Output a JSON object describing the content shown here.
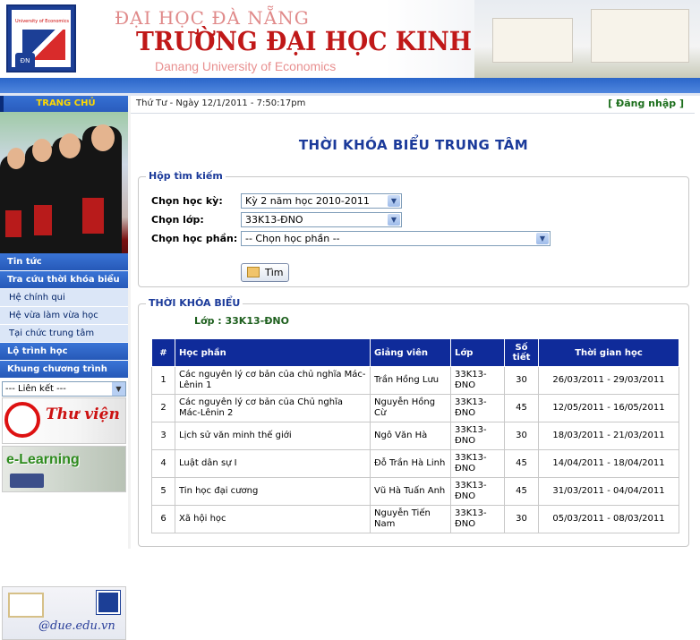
{
  "header": {
    "line1": "ĐẠI HỌC ĐÀ NẴNG",
    "line2": "TRƯỜNG ĐẠI HỌC KINH TẾ",
    "line3": "Danang University of Economics",
    "logo_text": "University of Economics",
    "logo_seal": "ĐN"
  },
  "sidebar": {
    "home": "TRANG CHỦ",
    "items": [
      {
        "label": "Tin tức",
        "type": "main"
      },
      {
        "label": "Tra cứu thời khóa biểu",
        "type": "main"
      },
      {
        "label": "Hệ chính qui",
        "type": "sub"
      },
      {
        "label": "Hệ vừa làm vừa học",
        "type": "sub"
      },
      {
        "label": "Tại chức trung tâm",
        "type": "sub"
      },
      {
        "label": "Lộ trình học",
        "type": "main"
      },
      {
        "label": "Khung chương trình",
        "type": "main"
      }
    ],
    "link_select": "--- Liên kết ---",
    "library": "Thư viện",
    "elearning": "e-Learning",
    "email": "@due.edu.vn"
  },
  "topbar": {
    "date": "Thứ Tư - Ngày 12/1/2011 - 7:50:17pm",
    "login": "[ Đăng nhập ]"
  },
  "page_title": "THỜI KHÓA BIỂU TRUNG TÂM",
  "search": {
    "legend": "Hộp tìm kiếm",
    "semester_label": "Chọn học kỳ:",
    "semester_value": "Kỳ 2 năm học 2010-2011",
    "class_label": "Chọn lớp:",
    "class_value": "33K13-ĐNO",
    "course_label": "Chọn học phần:",
    "course_value": "-- Chọn học phần --",
    "button": "Tìm"
  },
  "schedule": {
    "legend": "THỜI KHÓA BIỂU",
    "class_line": "Lớp : 33K13-ĐNO",
    "headers": [
      "#",
      "Học phần",
      "Giảng viên",
      "Lớp",
      "Số tiết",
      "Thời gian học"
    ],
    "rows": [
      {
        "no": "1",
        "course": "Các nguyên lý cơ bản của chủ nghĩa Mác-Lênin 1",
        "lecturer": "Trần Hồng Lưu",
        "class": "33K13-ĐNO",
        "periods": "30",
        "time": "26/03/2011 - 29/03/2011"
      },
      {
        "no": "2",
        "course": "Các nguyên lý cơ bản của Chủ nghĩa Mác-Lênin 2",
        "lecturer": "Nguyễn Hồng Cừ",
        "class": "33K13-ĐNO",
        "periods": "45",
        "time": "12/05/2011 - 16/05/2011"
      },
      {
        "no": "3",
        "course": "Lịch sử văn minh thế giới",
        "lecturer": "Ngô Văn Hà",
        "class": "33K13-ĐNO",
        "periods": "30",
        "time": "18/03/2011 - 21/03/2011"
      },
      {
        "no": "4",
        "course": "Luật dân sự I",
        "lecturer": "Đỗ Trần Hà Linh",
        "class": "33K13-ĐNO",
        "periods": "45",
        "time": "14/04/2011 - 18/04/2011"
      },
      {
        "no": "5",
        "course": "Tin học đại cương",
        "lecturer": "Vũ Hà Tuấn Anh",
        "class": "33K13-ĐNO",
        "periods": "45",
        "time": "31/03/2011 - 04/04/2011"
      },
      {
        "no": "6",
        "course": "Xã hội học",
        "lecturer": "Nguyễn Tiến Nam",
        "class": "33K13-ĐNO",
        "periods": "30",
        "time": "05/03/2011 - 08/03/2011"
      }
    ]
  },
  "colors": {
    "brand_blue": "#2a5cbd",
    "title_blue": "#1b3a9a",
    "header_red": "#c01818",
    "table_header": "#0f2b9a",
    "green": "#1d6f1d"
  }
}
